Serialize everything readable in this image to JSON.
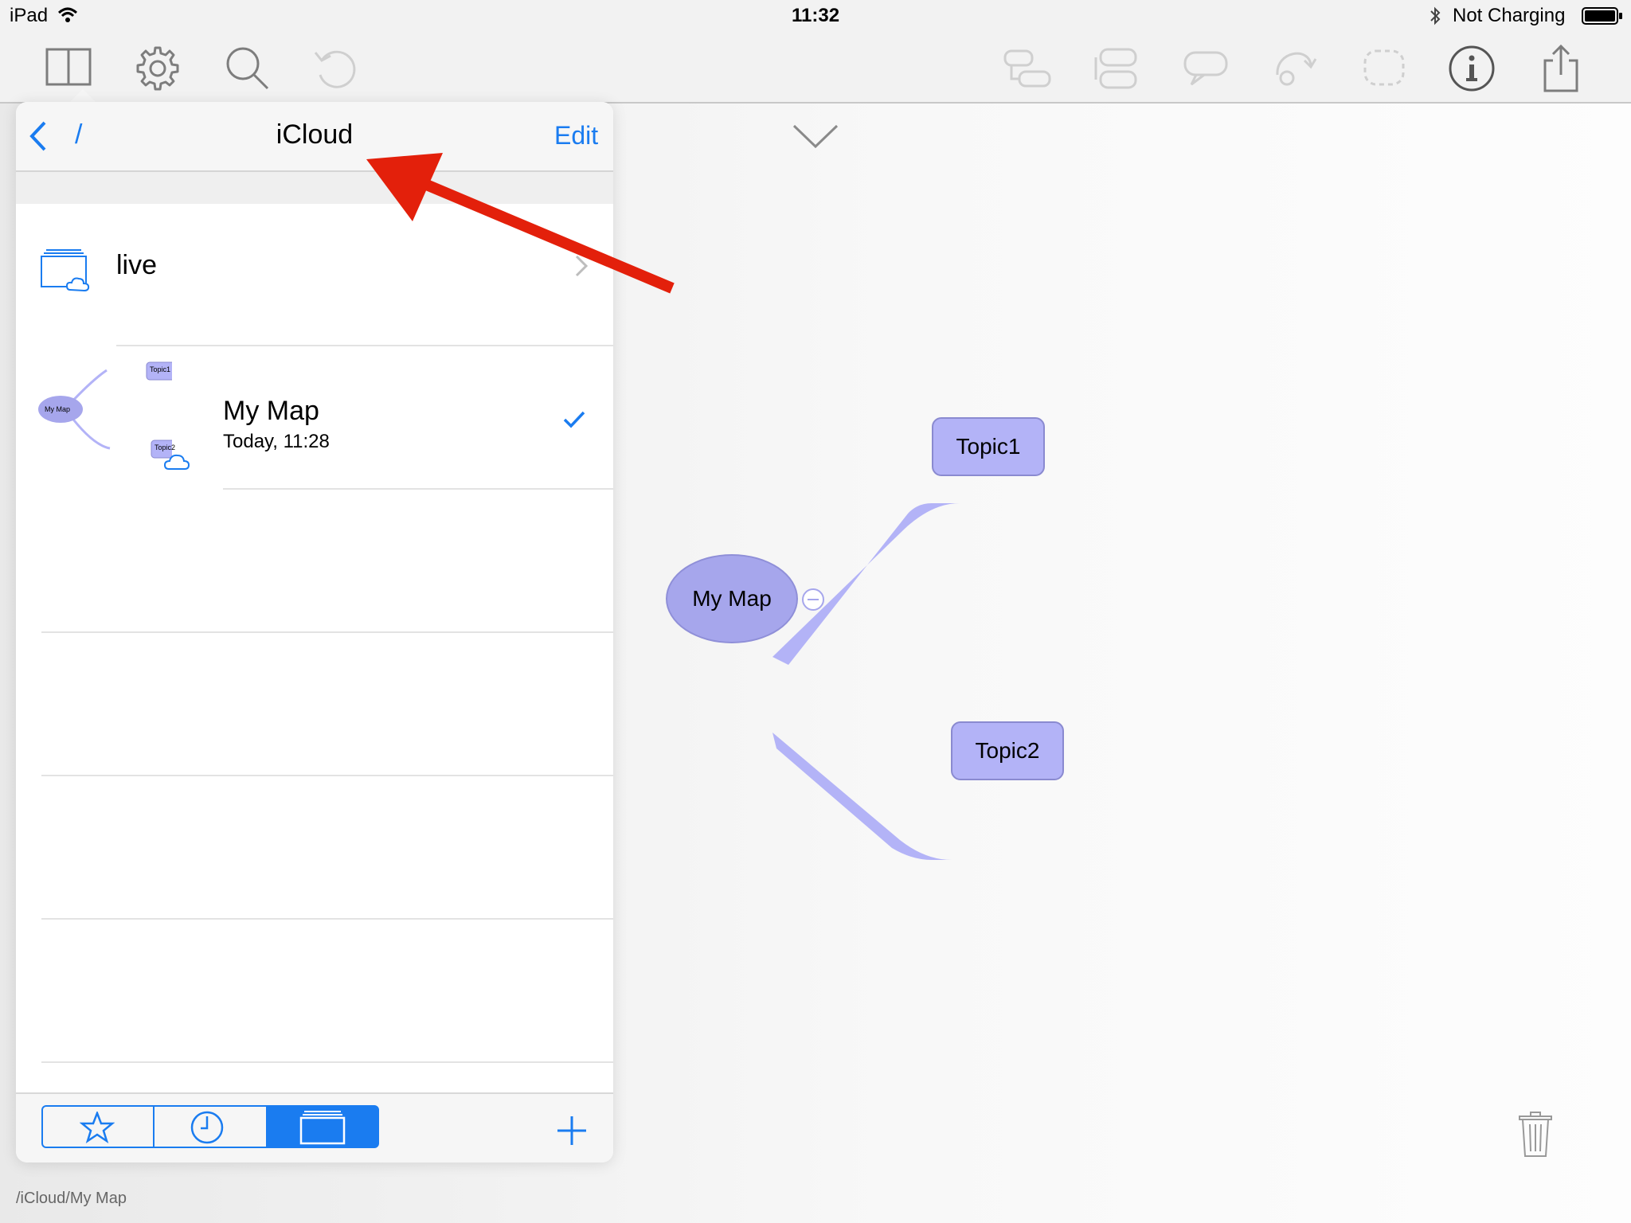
{
  "status_bar": {
    "device": "iPad",
    "time": "11:32",
    "battery_status": "Not Charging"
  },
  "toolbar": {
    "left_icons": [
      "library-icon",
      "gear-icon",
      "search-icon",
      "undo-icon"
    ],
    "right_icons": [
      "add-child-topic-icon",
      "add-sibling-topic-icon",
      "callout-icon",
      "relationship-icon",
      "boundary-icon",
      "info-icon",
      "share-icon"
    ]
  },
  "popover": {
    "nav": {
      "back_path": "/",
      "title": "iCloud",
      "edit_label": "Edit"
    },
    "folder": {
      "name": "live"
    },
    "file": {
      "name": "My Map",
      "modified": "Today, 11:28",
      "thumbnail": {
        "root": "My Map",
        "topics": [
          "Topic1",
          "Topic2"
        ]
      }
    },
    "footer": {
      "tabs": [
        "favorites-star-icon",
        "recent-clock-icon",
        "folders-icon"
      ],
      "active_tab": "folders-icon",
      "add_icon": "plus-icon"
    }
  },
  "mind_map": {
    "root": "My Map",
    "topics": [
      "Topic1",
      "Topic2"
    ],
    "node_fill": "#b3b3f7",
    "root_fill": "#a6a6ec"
  },
  "path_label": "/iCloud/My Map",
  "accent_color": "#1a7cf0",
  "annotation_arrow_color": "#e3200b"
}
